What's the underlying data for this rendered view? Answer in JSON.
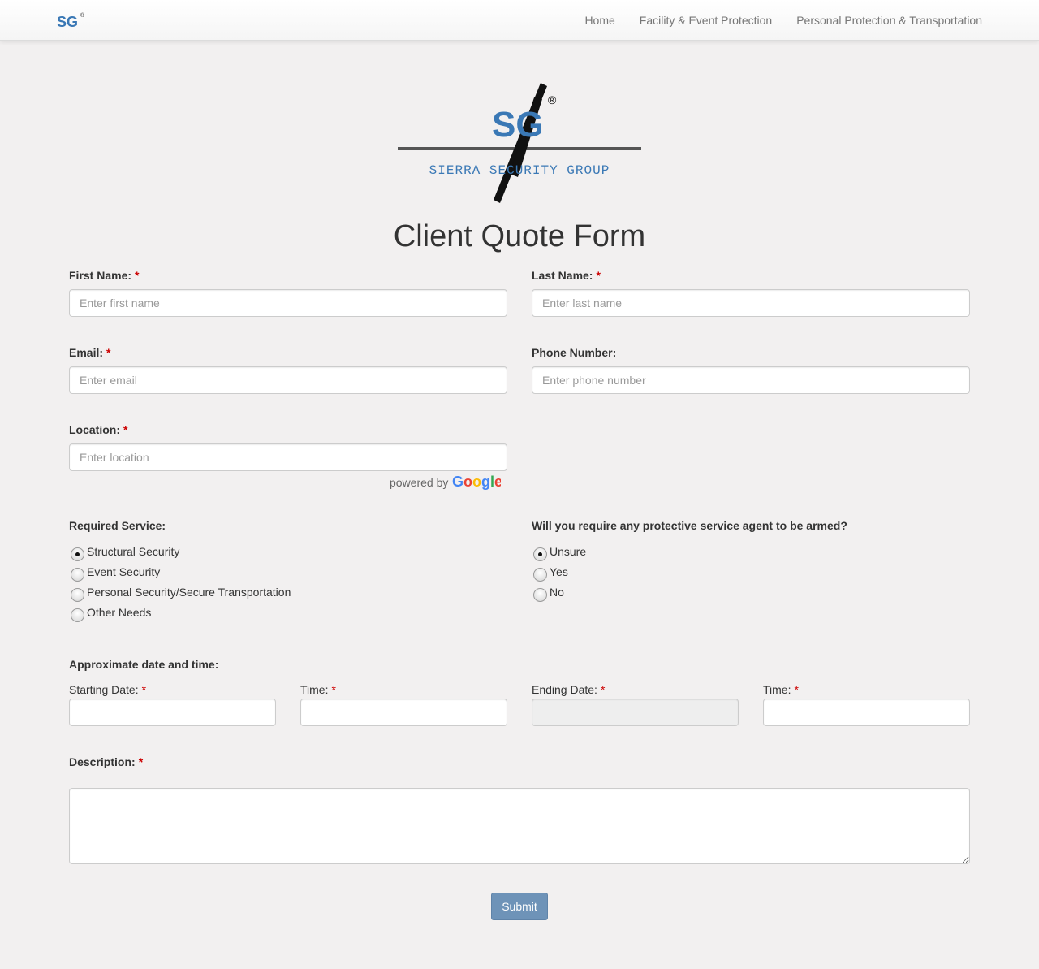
{
  "navbar": {
    "brand_text": "SG",
    "links": [
      "Home",
      "Facility & Event Protection",
      "Personal Protection & Transportation"
    ]
  },
  "logo": {
    "monogram": "SG",
    "registered": "®",
    "company": "SIERRA SECURITY GROUP"
  },
  "form": {
    "title": "Client Quote Form",
    "required_marker": "*",
    "first_name": {
      "label": "First Name:",
      "placeholder": "Enter first name",
      "value": ""
    },
    "last_name": {
      "label": "Last Name:",
      "placeholder": "Enter last name",
      "value": ""
    },
    "email": {
      "label": "Email:",
      "placeholder": "Enter email",
      "value": ""
    },
    "phone": {
      "label": "Phone Number:",
      "placeholder": "Enter phone number",
      "value": ""
    },
    "location": {
      "label": "Location:",
      "placeholder": "Enter location",
      "value": ""
    },
    "powered_by": "powered by",
    "google": "Google",
    "service": {
      "label": "Required Service:",
      "options": [
        "Structural Security",
        "Event Security",
        "Personal Security/Secure Transportation",
        "Other Needs"
      ],
      "selected": "Structural Security"
    },
    "armed": {
      "label": "Will you require any protective service agent to be armed?",
      "options": [
        "Unsure",
        "Yes",
        "No"
      ],
      "selected": "Unsure"
    },
    "datetime": {
      "heading": "Approximate date and time:",
      "start_date_label": "Starting Date:",
      "start_time_label": "Time:",
      "end_date_label": "Ending Date:",
      "end_time_label": "Time:"
    },
    "description": {
      "label": "Description:",
      "value": ""
    },
    "submit_label": "Submit"
  },
  "colors": {
    "page_bg": "#f2f0f0",
    "brand_blue": "#3a78b5",
    "submit_bg": "#6e93b8",
    "required": "#cc0000"
  }
}
